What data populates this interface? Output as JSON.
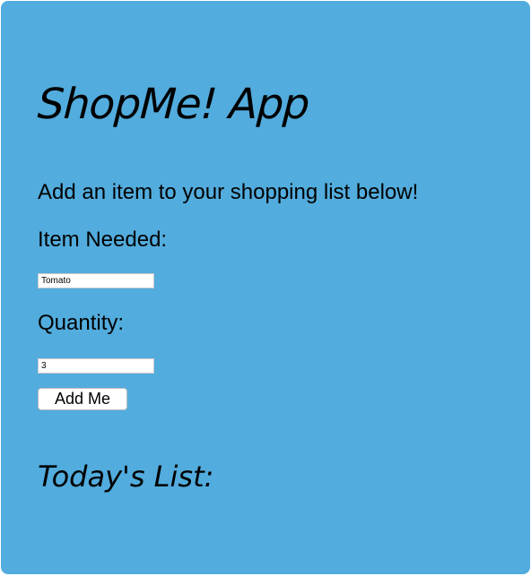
{
  "app": {
    "title": "ShopMe! App",
    "intro": "Add an item to your shopping list below!"
  },
  "form": {
    "item_label": "Item Needed:",
    "item_value": "Tomato",
    "quantity_label": "Quantity:",
    "quantity_value": "3",
    "add_button_label": "Add Me"
  },
  "list": {
    "title": "Today's List:",
    "items": []
  },
  "colors": {
    "panel_background": "#52acdd",
    "text": "#000000",
    "field_background": "#ffffff"
  }
}
